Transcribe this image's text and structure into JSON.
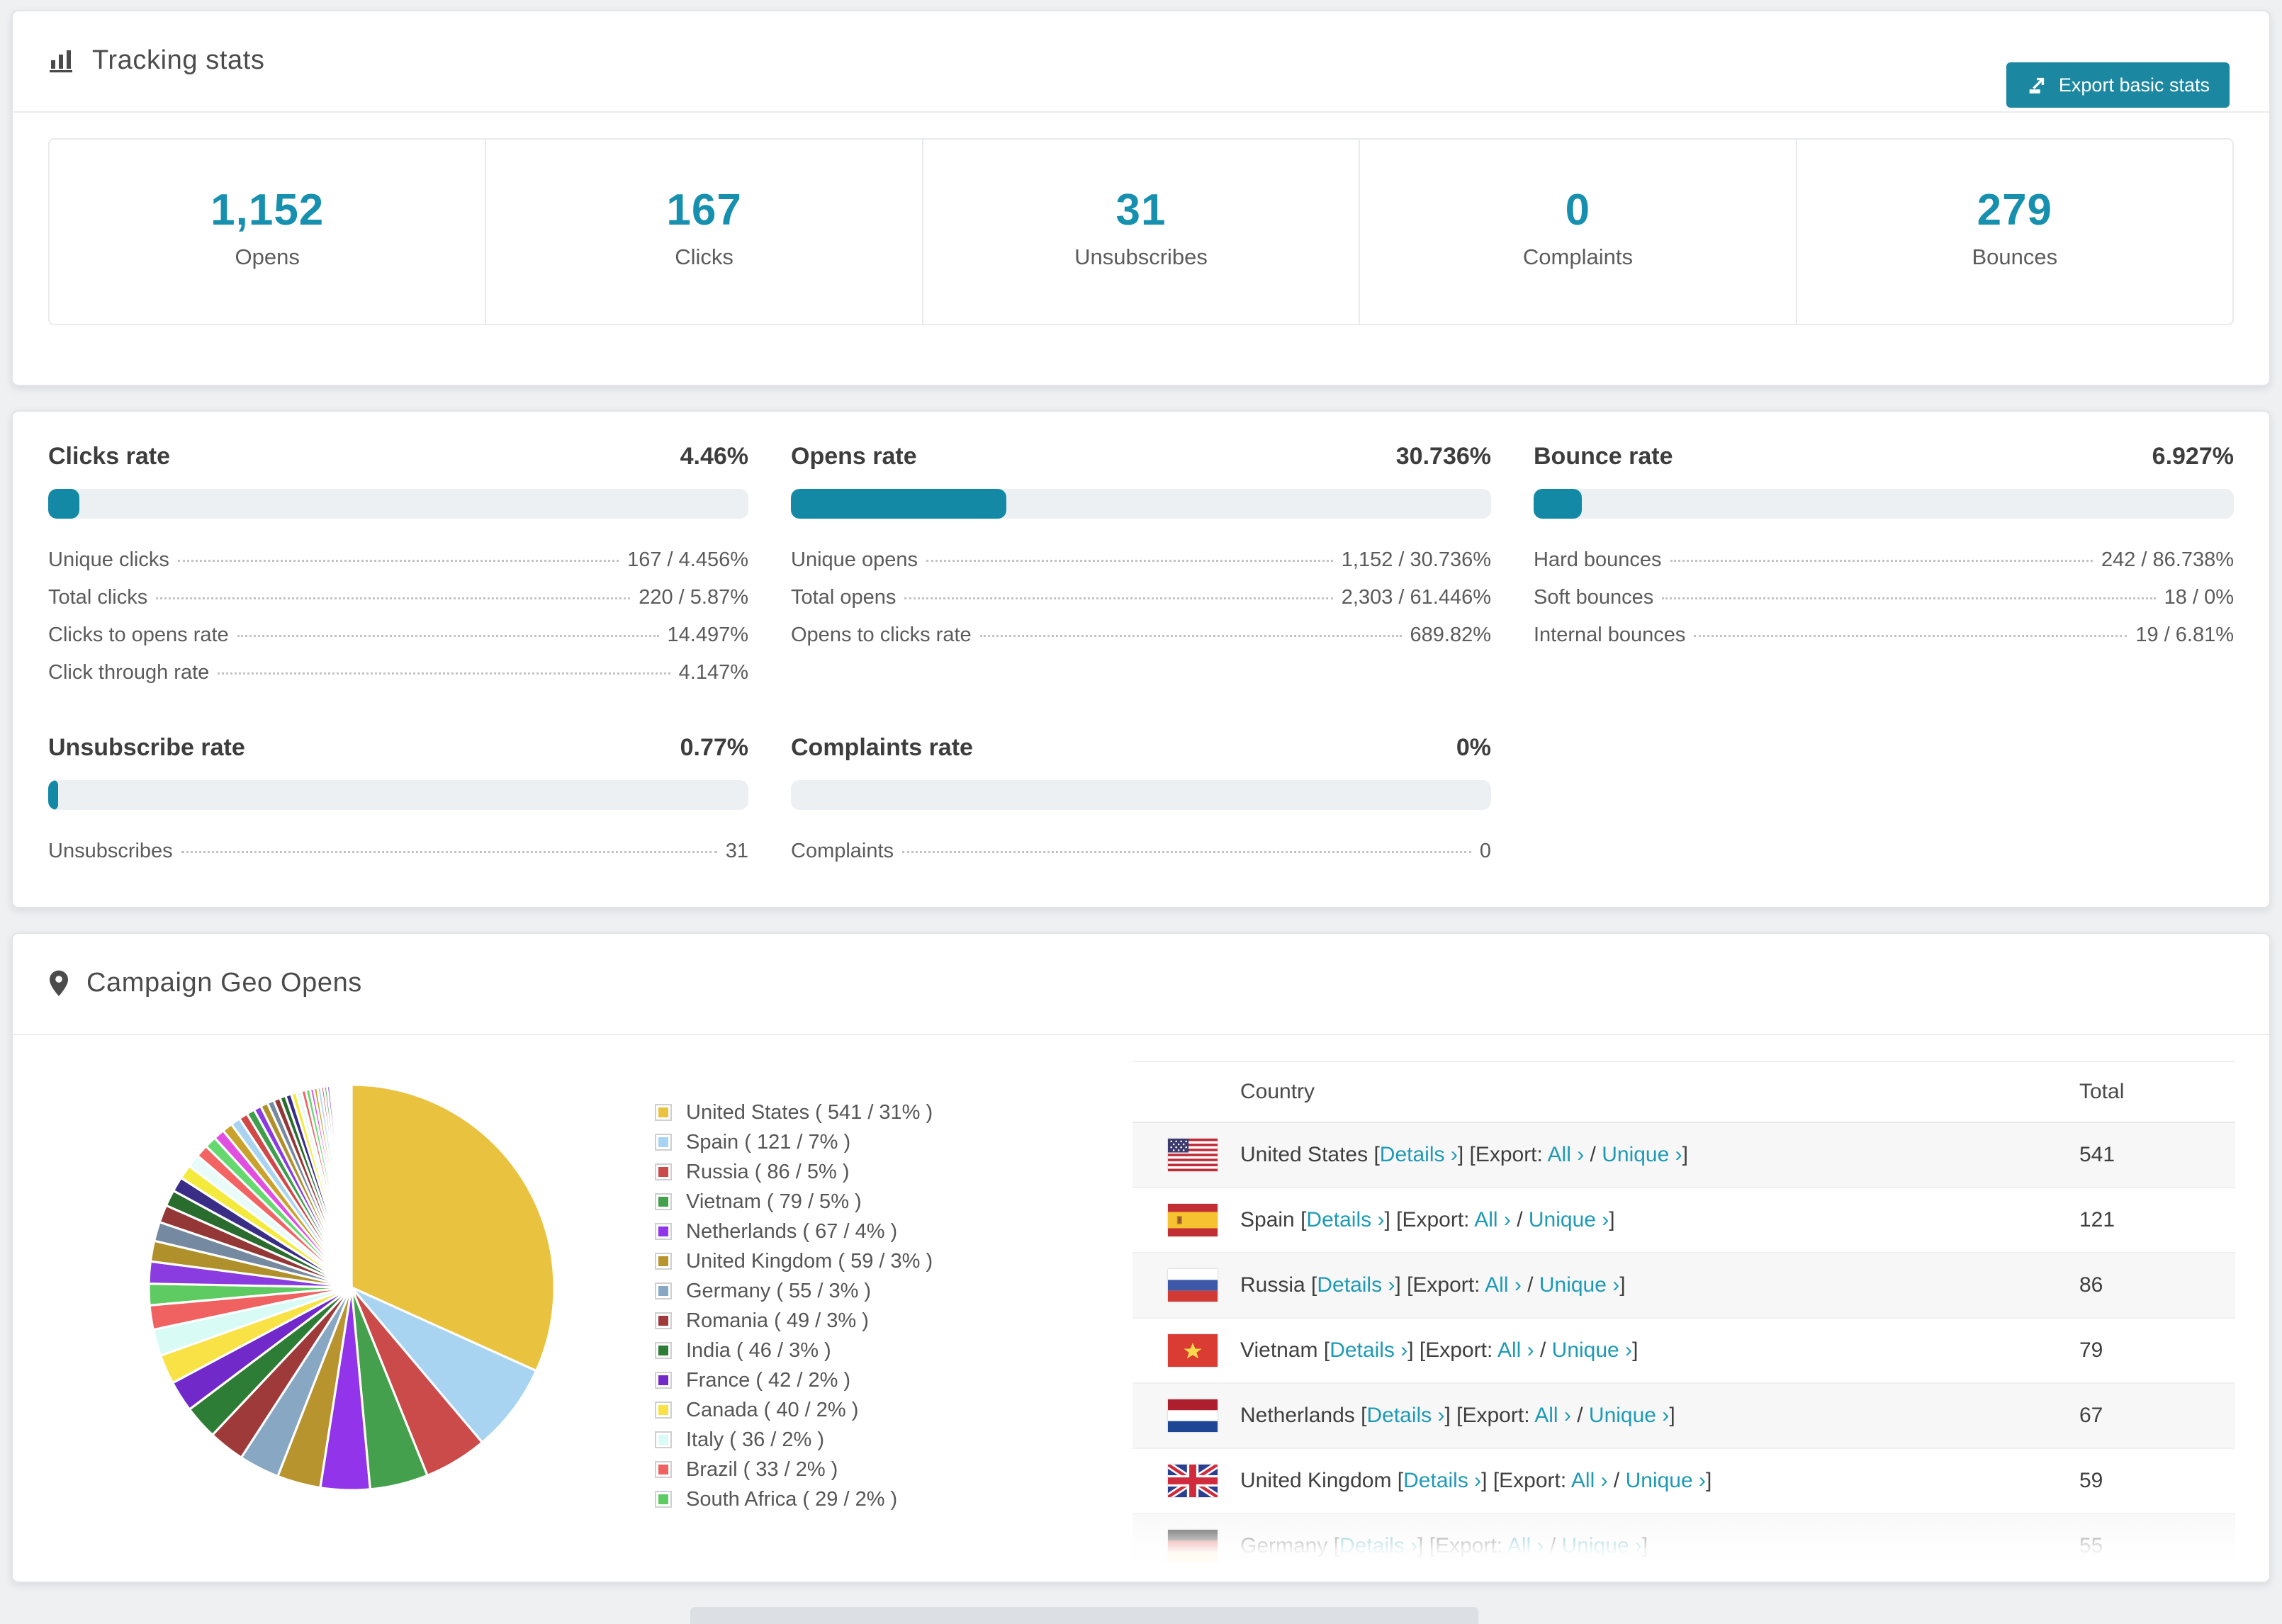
{
  "colors": {
    "accent": "#1690ae",
    "button_bg": "#1b87a0",
    "link": "#1e9ab5",
    "bar_fill": "#1489a6",
    "bar_bg": "#edf0f3",
    "row_alt_bg": "#f7f7f8"
  },
  "tracking": {
    "title": "Tracking stats",
    "icon": "bar-chart-icon",
    "export_button": {
      "label": "Export basic stats",
      "icon": "export-icon"
    },
    "stats": [
      {
        "key": "opens",
        "value": "1,152",
        "label": "Opens"
      },
      {
        "key": "clicks",
        "value": "167",
        "label": "Clicks"
      },
      {
        "key": "unsubscribes",
        "value": "31",
        "label": "Unsubscribes"
      },
      {
        "key": "complaints",
        "value": "0",
        "label": "Complaints"
      },
      {
        "key": "bounces",
        "value": "279",
        "label": "Bounces"
      }
    ]
  },
  "rates": {
    "panels": [
      {
        "key": "clicks",
        "title": "Clicks rate",
        "percent": "4.46%",
        "bar_pct": 4.46,
        "rows": [
          {
            "label": "Unique clicks",
            "value": "167 / 4.456%"
          },
          {
            "label": "Total clicks",
            "value": "220 / 5.87%"
          },
          {
            "label": "Clicks to opens rate",
            "value": "14.497%"
          },
          {
            "label": "Click through rate",
            "value": "4.147%"
          }
        ]
      },
      {
        "key": "opens",
        "title": "Opens rate",
        "percent": "30.736%",
        "bar_pct": 30.736,
        "rows": [
          {
            "label": "Unique opens",
            "value": "1,152 / 30.736%"
          },
          {
            "label": "Total opens",
            "value": "2,303 / 61.446%"
          },
          {
            "label": "Opens to clicks rate",
            "value": "689.82%"
          }
        ]
      },
      {
        "key": "bounce",
        "title": "Bounce rate",
        "percent": "6.927%",
        "bar_pct": 6.927,
        "rows": [
          {
            "label": "Hard bounces",
            "value": "242 / 86.738%"
          },
          {
            "label": "Soft bounces",
            "value": "18 / 0%"
          },
          {
            "label": "Internal bounces",
            "value": "19 / 6.81%"
          }
        ]
      },
      {
        "key": "unsubscribe",
        "title": "Unsubscribe rate",
        "percent": "0.77%",
        "bar_pct": 0.77,
        "rows": [
          {
            "label": "Unsubscribes",
            "value": "31"
          }
        ]
      },
      {
        "key": "complaints",
        "title": "Complaints rate",
        "percent": "0%",
        "bar_pct": 0,
        "rows": [
          {
            "label": "Complaints",
            "value": "0"
          }
        ]
      }
    ]
  },
  "geo": {
    "title": "Campaign Geo Opens",
    "icon": "map-pin-icon",
    "table": {
      "headers": [
        "Country",
        "Total"
      ],
      "link_labels": {
        "details": "Details",
        "export": "Export:",
        "all": "All",
        "unique": "Unique",
        "chevron": "›"
      },
      "rows": [
        {
          "country": "United States",
          "flag": "us",
          "total": "541"
        },
        {
          "country": "Spain",
          "flag": "es",
          "total": "121"
        },
        {
          "country": "Russia",
          "flag": "ru",
          "total": "86"
        },
        {
          "country": "Vietnam",
          "flag": "vn",
          "total": "79"
        },
        {
          "country": "Netherlands",
          "flag": "nl",
          "total": "67"
        },
        {
          "country": "United Kingdom",
          "flag": "gb",
          "total": "59"
        },
        {
          "country": "Germany",
          "flag": "de",
          "total": "55",
          "partial": true
        }
      ]
    }
  },
  "chart_data": {
    "type": "pie",
    "title": "Campaign Geo Opens",
    "legend_position": "right",
    "start_angle_deg": 0,
    "slices": [
      {
        "label": "United States",
        "value": 541,
        "pct": 31,
        "color": "#e9c23f"
      },
      {
        "label": "Spain",
        "value": 121,
        "pct": 7,
        "color": "#a8d4f2"
      },
      {
        "label": "Russia",
        "value": 86,
        "pct": 5,
        "color": "#cb4a4a"
      },
      {
        "label": "Vietnam",
        "value": 79,
        "pct": 5,
        "color": "#44a04c"
      },
      {
        "label": "Netherlands",
        "value": 67,
        "pct": 4,
        "color": "#9134ea"
      },
      {
        "label": "United Kingdom",
        "value": 59,
        "pct": 3,
        "color": "#b8942e"
      },
      {
        "label": "Germany",
        "value": 55,
        "pct": 3,
        "color": "#88a7c3"
      },
      {
        "label": "Romania",
        "value": 49,
        "pct": 3,
        "color": "#9e3a3a"
      },
      {
        "label": "India",
        "value": 46,
        "pct": 3,
        "color": "#2e7d36"
      },
      {
        "label": "France",
        "value": 42,
        "pct": 2,
        "color": "#7229c9"
      },
      {
        "label": "Canada",
        "value": 40,
        "pct": 2,
        "color": "#f8e245"
      },
      {
        "label": "Italy",
        "value": 36,
        "pct": 2,
        "color": "#d8fbf6"
      },
      {
        "label": "Brazil",
        "value": 33,
        "pct": 2,
        "color": "#f06262"
      },
      {
        "label": "South Africa",
        "value": 29,
        "pct": 2,
        "color": "#5ecb62"
      }
    ],
    "others_values": [
      30,
      28,
      26,
      24,
      22,
      20,
      19,
      18,
      17,
      16,
      15,
      14,
      13,
      12,
      11,
      10,
      10,
      9,
      9,
      8,
      8,
      7,
      7,
      6,
      6,
      5,
      5,
      5,
      4,
      4,
      4,
      3,
      3,
      3,
      3,
      2,
      2,
      2,
      2,
      1,
      1,
      1,
      1,
      1,
      1,
      1,
      1,
      1
    ],
    "others_palette": [
      "#8a3ce0",
      "#b0902a",
      "#7589a0",
      "#943737",
      "#2a6b2e",
      "#3a2d85",
      "#f4ea3d",
      "#e8fbf8",
      "#f26464",
      "#65d96f",
      "#e14fe1",
      "#c8a22c",
      "#a8d4f2",
      "#d04848",
      "#3f9e4b"
    ]
  }
}
